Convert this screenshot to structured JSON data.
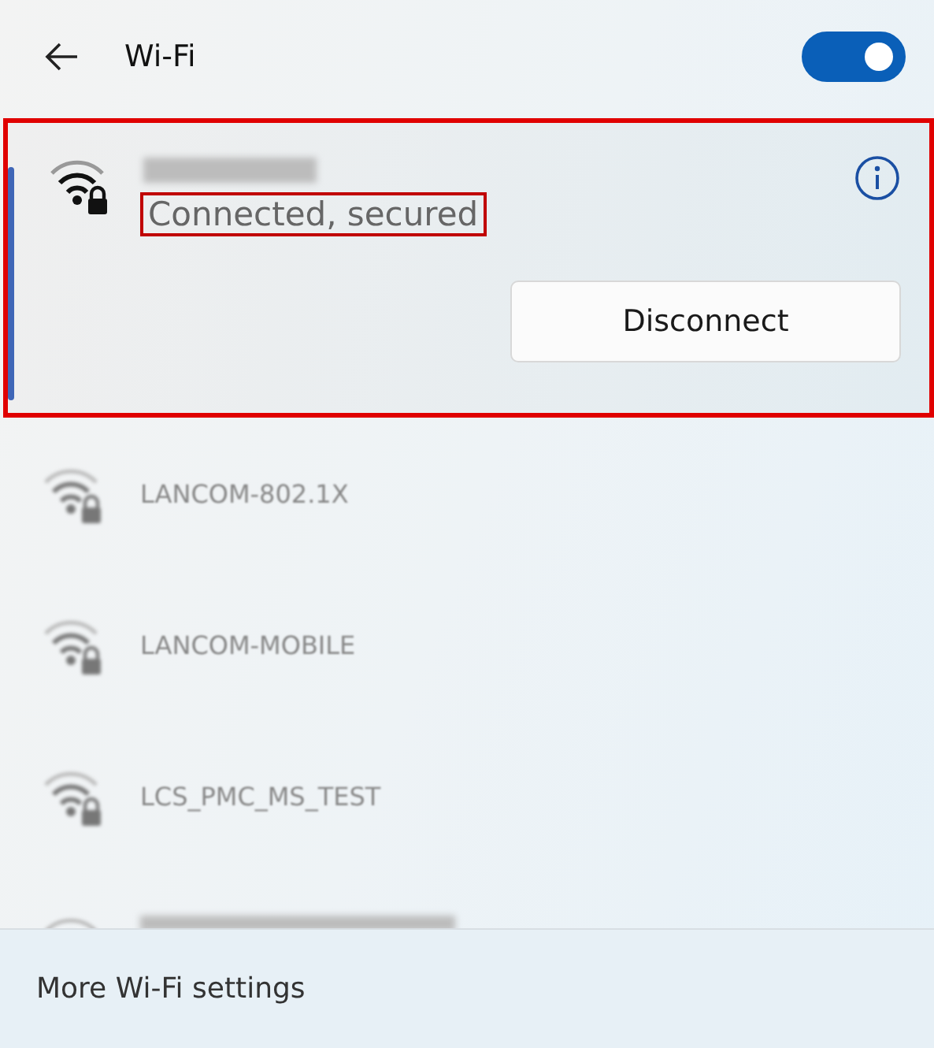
{
  "header": {
    "title": "Wi-Fi",
    "wifi_on": true
  },
  "networks": [
    {
      "kind": "connected",
      "secured": true,
      "status": "Connected, secured",
      "action": "Disconnect",
      "highlighted": true
    },
    {
      "kind": "available",
      "secured": true,
      "name": "LANCOM-802.1X"
    },
    {
      "kind": "available",
      "secured": true,
      "name": "LANCOM-MOBILE"
    },
    {
      "kind": "available",
      "secured": true,
      "name": "LCS_PMC_MS_TEST"
    },
    {
      "kind": "partial"
    }
  ],
  "footer": {
    "link": "More Wi-Fi settings"
  }
}
